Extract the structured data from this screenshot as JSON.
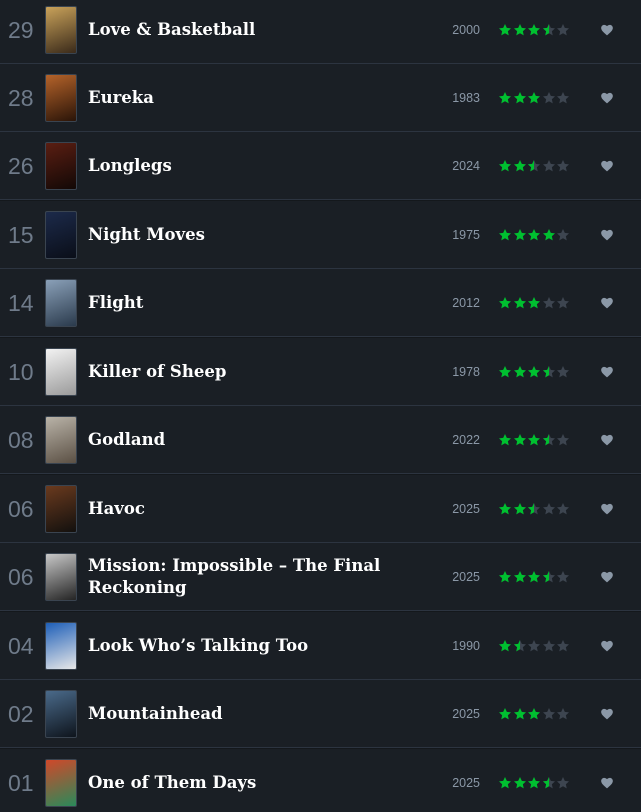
{
  "colors": {
    "background": "#14181c",
    "row_background": "#1a1f25",
    "divider": "#2c3440",
    "day_number": "#6f7b8a",
    "title": "#ffffff",
    "year": "#8b98a7",
    "star_filled": "#00c030",
    "star_empty": "#3d4550",
    "heart": "#8b98a7"
  },
  "entries": [
    {
      "day": "29",
      "title": "Love & Basketball",
      "year": "2000",
      "rating": 3.5,
      "poster_colors": [
        "#c9a25a",
        "#3a2a1a"
      ]
    },
    {
      "day": "28",
      "title": "Eureka",
      "year": "1983",
      "rating": 3,
      "poster_colors": [
        "#b5632a",
        "#2a1408"
      ]
    },
    {
      "day": "26",
      "title": "Longlegs",
      "year": "2024",
      "rating": 2.5,
      "poster_colors": [
        "#5a1e12",
        "#120806"
      ]
    },
    {
      "day": "15",
      "title": "Night Moves",
      "year": "1975",
      "rating": 4,
      "poster_colors": [
        "#1c2a4a",
        "#0a0e18"
      ]
    },
    {
      "day": "14",
      "title": "Flight",
      "year": "2012",
      "rating": 3,
      "poster_colors": [
        "#8aa0b8",
        "#2a3a4c"
      ]
    },
    {
      "day": "10",
      "title": "Killer of Sheep",
      "year": "1978",
      "rating": 3.5,
      "poster_colors": [
        "#f2f2f2",
        "#9a9a9a"
      ]
    },
    {
      "day": "08",
      "title": "Godland",
      "year": "2022",
      "rating": 3.5,
      "poster_colors": [
        "#b9b3a8",
        "#5b5044"
      ]
    },
    {
      "day": "06",
      "title": "Havoc",
      "year": "2025",
      "rating": 2.5,
      "poster_colors": [
        "#6a3a1e",
        "#12100e"
      ]
    },
    {
      "day": "06",
      "title": "Mission: Impossible – The Final Reckoning",
      "year": "2025",
      "rating": 3.5,
      "poster_colors": [
        "#c8c8c8",
        "#242424"
      ]
    },
    {
      "day": "04",
      "title": "Look Who’s Talking Too",
      "year": "1990",
      "rating": 1.5,
      "poster_colors": [
        "#1e5fb8",
        "#e8e8e8"
      ]
    },
    {
      "day": "02",
      "title": "Mountainhead",
      "year": "2025",
      "rating": 3,
      "poster_colors": [
        "#4a6a8a",
        "#0e141c"
      ]
    },
    {
      "day": "01",
      "title": "One of Them Days",
      "year": "2025",
      "rating": 3.5,
      "poster_colors": [
        "#d0482a",
        "#2a8a5a"
      ]
    }
  ]
}
